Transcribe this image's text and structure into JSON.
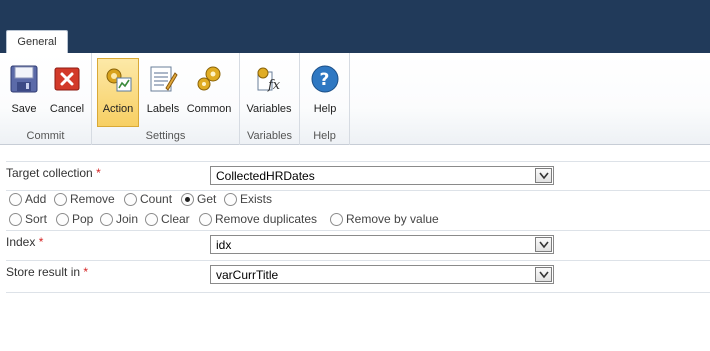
{
  "ribbon": {
    "tab": "General",
    "groups": [
      {
        "label": "Commit"
      },
      {
        "label": "Settings"
      },
      {
        "label": "Variables"
      },
      {
        "label": "Help"
      }
    ],
    "buttons": {
      "save": "Save",
      "cancel": "Cancel",
      "action": "Action",
      "labels": "Labels",
      "common": "Common",
      "variables": "Variables",
      "help": "Help"
    }
  },
  "form": {
    "target_collection": {
      "label": "Target collection",
      "required": "*",
      "value": "CollectedHRDates"
    },
    "operations_row1": [
      "Add",
      "Remove",
      "Count",
      "Get",
      "Exists"
    ],
    "operations_row2": [
      "Sort",
      "Pop",
      "Join",
      "Clear",
      "Remove duplicates",
      "Remove by value"
    ],
    "selected_operation": "Get",
    "index": {
      "label": "Index",
      "required": "*",
      "value": "idx"
    },
    "store_result": {
      "label": "Store result in",
      "required": "*",
      "value": "varCurrTitle"
    }
  },
  "colors": {
    "title_bar": "#213a5a",
    "active_button": "#f7cf63",
    "required": "#d42424"
  },
  "icons": [
    "save-icon",
    "cancel-icon",
    "action-icon",
    "labels-icon",
    "common-icon",
    "variables-icon",
    "help-icon",
    "dropdown-arrow-icon"
  ]
}
